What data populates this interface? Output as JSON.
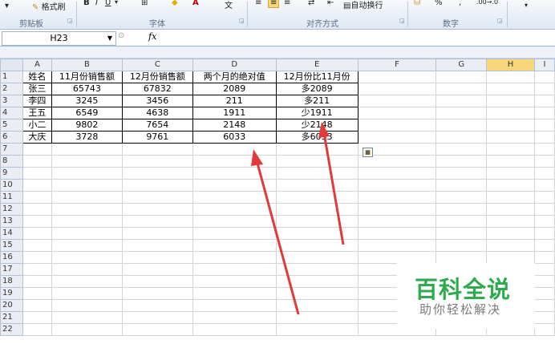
{
  "ribbon": {
    "clipboard_label": "剪贴板",
    "format_painter": "格式刷",
    "font_label": "字体",
    "alignment_label": "对齐方式",
    "number_label": "数字",
    "wrap_text": "自动换行",
    "percent_symbol": "%"
  },
  "formula_bar": {
    "name_box": "H23",
    "fx": "fx"
  },
  "columns": [
    "A",
    "B",
    "C",
    "D",
    "E",
    "F",
    "G",
    "H",
    "I"
  ],
  "rows": [
    "1",
    "2",
    "3",
    "4",
    "5",
    "6",
    "7",
    "8",
    "9",
    "10",
    "11",
    "12",
    "13",
    "14",
    "15",
    "16",
    "17",
    "18",
    "19",
    "20",
    "21",
    "22"
  ],
  "table": {
    "headers": [
      "姓名",
      "11月份销售额",
      "12月份销售额",
      "两个月的绝对值",
      "12月份比11月份"
    ],
    "rows": [
      [
        "张三",
        "65743",
        "67832",
        "2089",
        "多2089"
      ],
      [
        "李四",
        "3245",
        "3456",
        "211",
        "多211"
      ],
      [
        "王五",
        "6549",
        "4638",
        "1911",
        "少1911"
      ],
      [
        "小二",
        "9802",
        "7654",
        "2148",
        "少2148"
      ],
      [
        "大庆",
        "3728",
        "9761",
        "6033",
        "多6033"
      ]
    ]
  },
  "watermark": {
    "title": "百科全说",
    "subtitle": "助你轻松解决"
  },
  "colors": {
    "selected_column_header": "#f7d77a",
    "arrow": "#e03a3a",
    "watermark_green": "#2faa4e"
  }
}
